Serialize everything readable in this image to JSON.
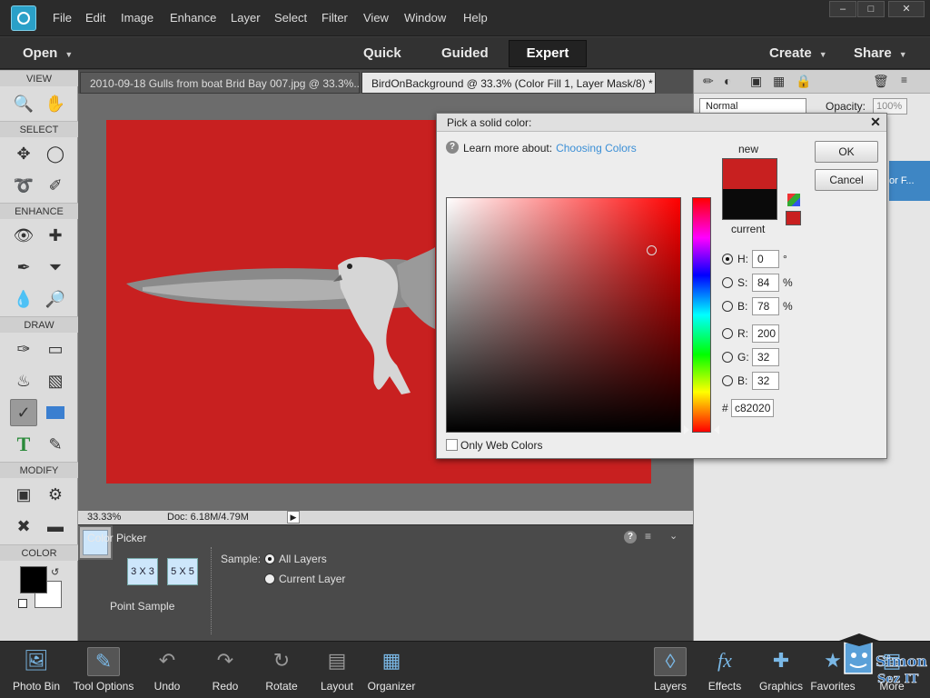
{
  "menu": {
    "items": [
      "File",
      "Edit",
      "Image",
      "Enhance",
      "Layer",
      "Select",
      "Filter",
      "View",
      "Window",
      "Help"
    ]
  },
  "modebar": {
    "open_label": "Open",
    "quick_label": "Quick",
    "guided_label": "Guided",
    "expert_label": "Expert",
    "create_label": "Create",
    "share_label": "Share"
  },
  "toolbox": {
    "sections": {
      "view": "VIEW",
      "select": "SELECT",
      "enhance": "ENHANCE",
      "draw": "DRAW",
      "modify": "MODIFY",
      "color": "COLOR"
    },
    "active_tool": "eyedropper-icon"
  },
  "doc_tabs": [
    {
      "label": "2010-09-18 Gulls from boat Brid Bay 007.jpg @ 33.3%...",
      "active": false
    },
    {
      "label": "BirdOnBackground @ 33.3% (Color Fill 1, Layer Mask/8) *",
      "active": true
    }
  ],
  "canvas": {
    "fill_color": "#c82020"
  },
  "status": {
    "zoom": "33.33%",
    "doc_size": "Doc: 6.18M/4.79M"
  },
  "tool_options": {
    "title": "Color Picker",
    "sample_sizes": [
      "3 X 3",
      "5 X 5"
    ],
    "point_sample_label": "Point Sample",
    "sample_label": "Sample:",
    "all_layers_label": "All Layers",
    "current_layer_label": "Current Layer"
  },
  "right_panel": {
    "blend_mode": "Normal",
    "opacity_label": "Opacity:",
    "opacity_value": "100%",
    "layer_peek_text": "or F..."
  },
  "dialog": {
    "title": "Pick a solid color:",
    "learn_more": "Learn more about:",
    "learn_link": "Choosing Colors",
    "new_label": "new",
    "current_label": "current",
    "ok_label": "OK",
    "cancel_label": "Cancel",
    "fields": {
      "h": {
        "label": "H:",
        "value": "0",
        "unit": "°"
      },
      "s": {
        "label": "S:",
        "value": "84",
        "unit": "%"
      },
      "b": {
        "label": "B:",
        "value": "78",
        "unit": "%"
      },
      "r": {
        "label": "R:",
        "value": "200",
        "unit": ""
      },
      "g": {
        "label": "G:",
        "value": "32",
        "unit": ""
      },
      "b2": {
        "label": "B:",
        "value": "32",
        "unit": ""
      }
    },
    "hex_label": "#",
    "hex_value": "c82020",
    "web_colors_label": "Only Web Colors",
    "new_color": "#c82020",
    "current_color": "#0a0a0a"
  },
  "taskbar": {
    "photo_bin": "Photo Bin",
    "tool_options": "Tool Options",
    "undo": "Undo",
    "redo": "Redo",
    "rotate": "Rotate",
    "layout": "Layout",
    "organizer": "Organizer",
    "layers": "Layers",
    "effects": "Effects",
    "graphics": "Graphics",
    "favorites": "Favorites",
    "more": "More"
  },
  "watermark": {
    "text": "Simon Sez IT"
  }
}
